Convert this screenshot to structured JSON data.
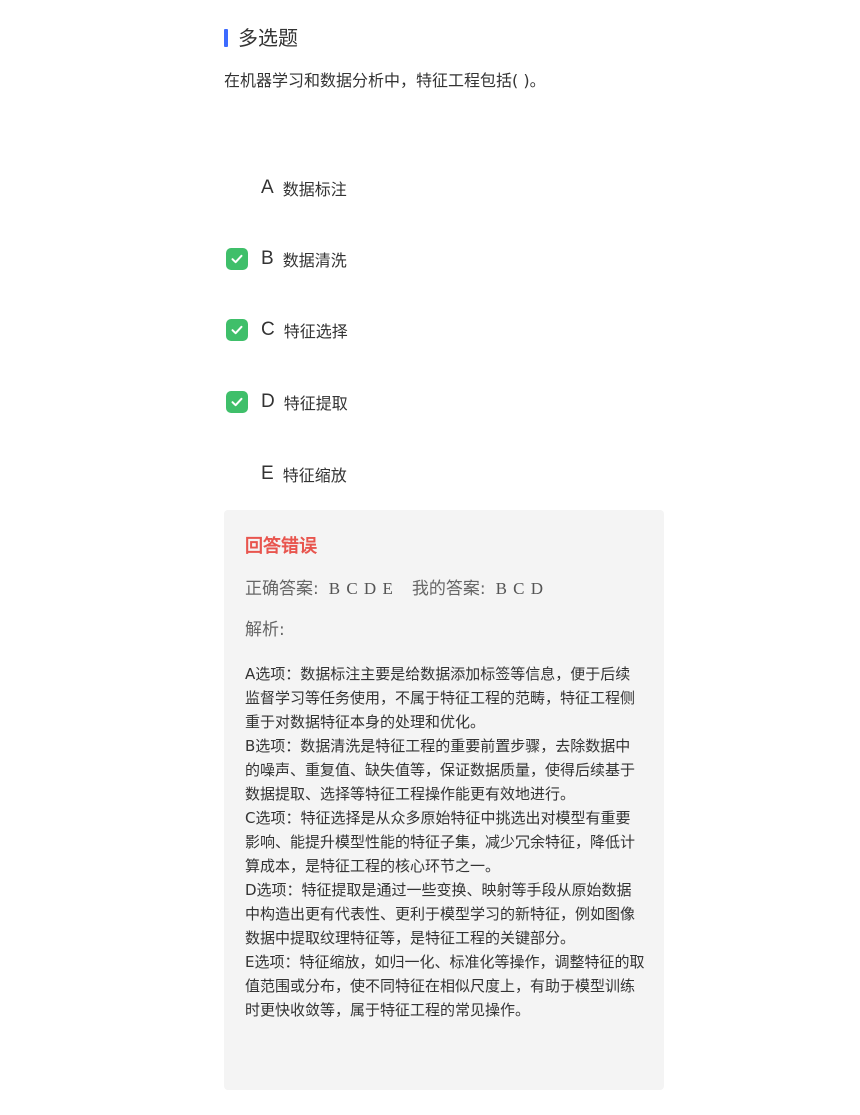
{
  "section": {
    "title": "多选题"
  },
  "question": {
    "text": "在机器学习和数据分析中，特征工程包括( )。"
  },
  "options": [
    {
      "letter": "A",
      "text": "数据标注",
      "selected": false
    },
    {
      "letter": "B",
      "text": "数据清洗",
      "selected": true
    },
    {
      "letter": "C",
      "text": "特征选择",
      "selected": true
    },
    {
      "letter": "D",
      "text": "特征提取",
      "selected": true
    },
    {
      "letter": "E",
      "text": "特征缩放",
      "selected": false
    }
  ],
  "result": {
    "status": "回答错误",
    "correct_label": "正确答案:",
    "correct_value": "B C D E",
    "mine_label": "我的答案:",
    "mine_value": "B C D",
    "analysis_label": "解析:",
    "analysis": [
      "A选项：数据标注主要是给数据添加标签等信息，便于后续监督学习等任务使用，不属于特征工程的范畴，特征工程侧重于对数据特征本身的处理和优化。",
      "B选项：数据清洗是特征工程的重要前置步骤，去除数据中的噪声、重复值、缺失值等，保证数据质量，使得后续基于数据提取、选择等特征工程操作能更有效地进行。",
      "C选项：特征选择是从众多原始特征中挑选出对模型有重要影响、能提升模型性能的特征子集，减少冗余特征，降低计算成本，是特征工程的核心环节之一。",
      "D选项：特征提取是通过一些变换、映射等手段从原始数据中构造出更有代表性、更利于模型学习的新特征，例如图像数据中提取纹理特征等，是特征工程的关键部分。",
      "E选项：特征缩放，如归一化、标准化等操作，调整特征的取值范围或分布，使不同特征在相似尺度上，有助于模型训练时更快收敛等，属于特征工程的常见操作。"
    ]
  },
  "colors": {
    "accent_bar": "#3d6bff",
    "checkbox_checked": "#3fbf6a",
    "status_wrong": "#e8554e",
    "panel_bg": "#f4f4f4"
  },
  "icons": {
    "checked": "checkmark-icon"
  }
}
